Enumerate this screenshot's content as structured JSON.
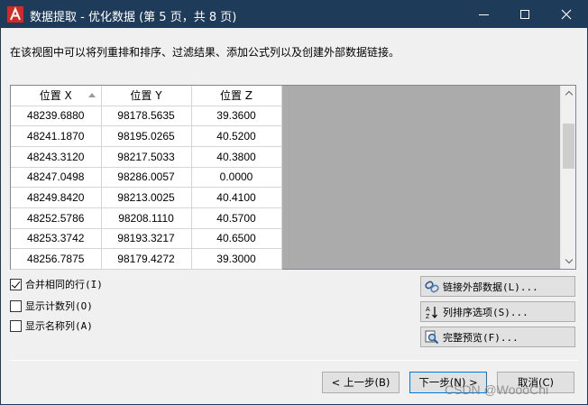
{
  "window": {
    "title": "数据提取 - 优化数据 (第 5 页，共 8 页)"
  },
  "instruction": "在该视图中可以将列重排和排序、过滤结果、添加公式列以及创建外部数据链接。",
  "grid": {
    "columns": [
      "位置 X",
      "位置 Y",
      "位置 Z"
    ],
    "sorted_column": "位置 X",
    "rows": [
      [
        "48239.6880",
        "98178.5635",
        "39.3600"
      ],
      [
        "48241.1870",
        "98195.0265",
        "40.5200"
      ],
      [
        "48243.3120",
        "98217.5033",
        "40.3800"
      ],
      [
        "48247.0498",
        "98286.0057",
        "0.0000"
      ],
      [
        "48249.8420",
        "98213.0025",
        "40.4100"
      ],
      [
        "48252.5786",
        "98208.1110",
        "40.5700"
      ],
      [
        "48253.3742",
        "98193.3217",
        "40.6500"
      ],
      [
        "48256.7875",
        "98179.4272",
        "39.3000"
      ]
    ]
  },
  "options": {
    "merge_rows": {
      "label": "合并相同的行(I)",
      "checked": true
    },
    "show_count": {
      "label": "显示计数列(O)",
      "checked": false
    },
    "show_name": {
      "label": "显示名称列(A)",
      "checked": false
    }
  },
  "side_buttons": {
    "link_external": {
      "label": "链接外部数据(L)...",
      "icon": "link-icon"
    },
    "sort_options": {
      "label": "列排序选项(S)...",
      "icon": "sort-az-icon"
    },
    "full_preview": {
      "label": "完整预览(F)...",
      "icon": "preview-magnifier-icon"
    }
  },
  "nav": {
    "back": "< 上一步(B)",
    "next": "下一步(N) >",
    "cancel": "取消(C)"
  },
  "watermark": "CSDN @WoooChi",
  "colors": {
    "titlebar": "#1e3c5a",
    "autocad_red": "#d22b27",
    "grid_background": "#ababab"
  }
}
